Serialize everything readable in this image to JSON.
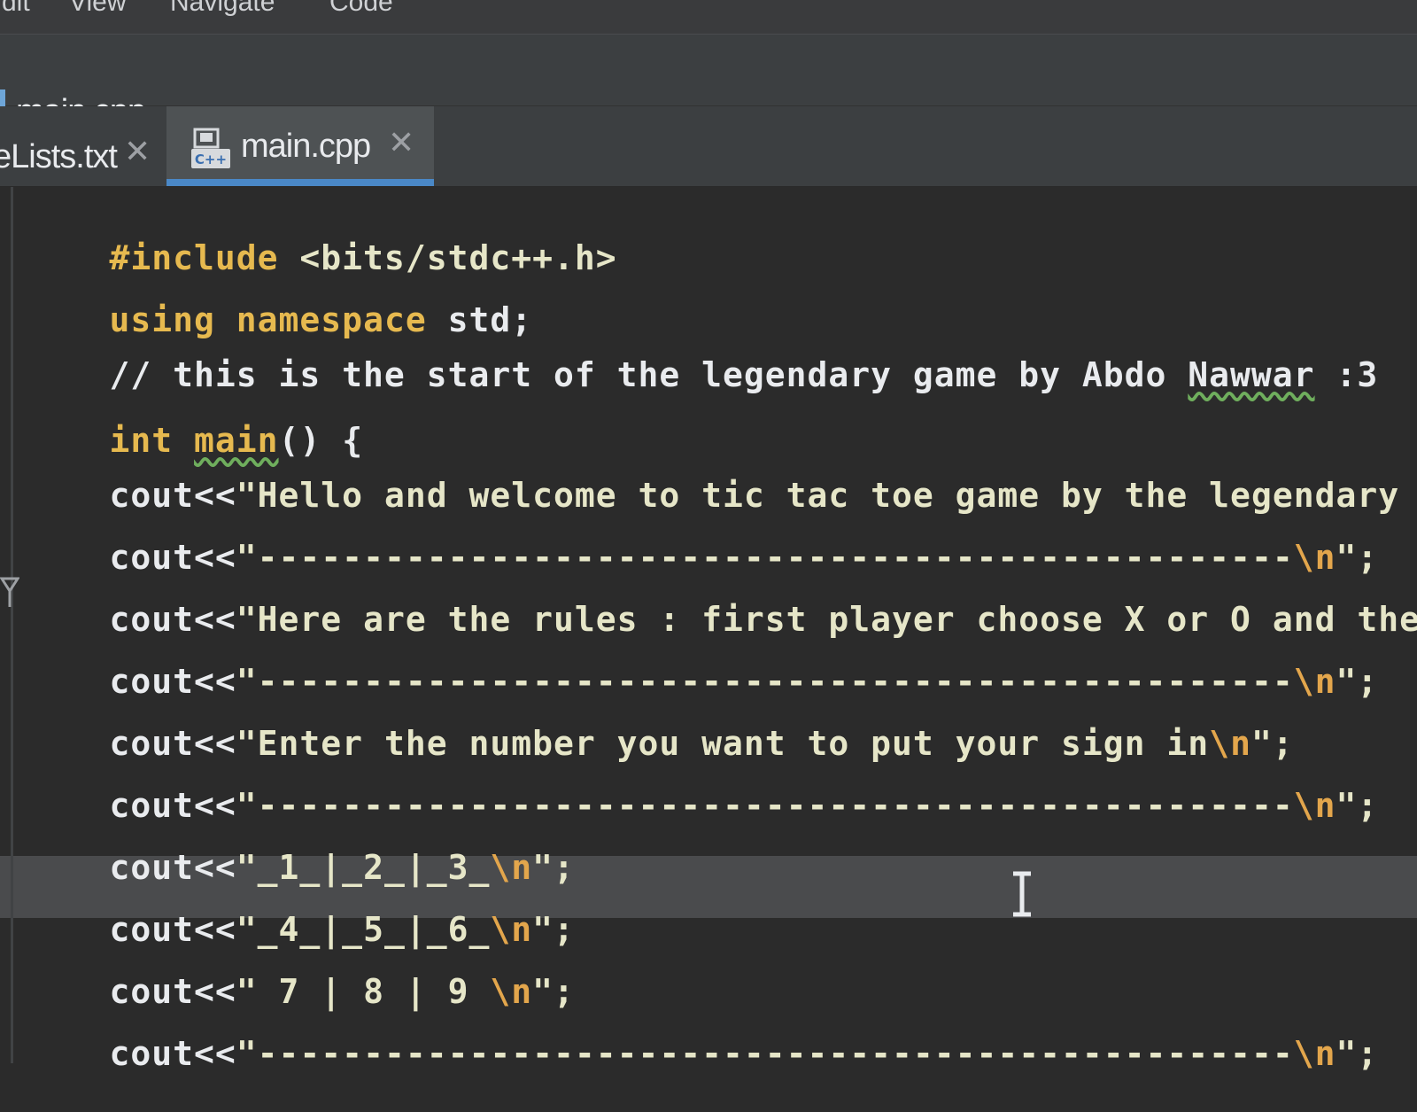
{
  "menubar": {
    "items": [
      "dit",
      "View",
      "Navigate",
      "Code"
    ]
  },
  "breadcrumb": {
    "file": "main.cpp"
  },
  "tabs": [
    {
      "label": "eLists.txt",
      "active": false
    },
    {
      "label": "main.cpp",
      "active": true,
      "icon": "cpp-file-icon"
    }
  ],
  "editor": {
    "lines": {
      "l1": {
        "kw": "#include",
        "text": " <bits/stdc++.h>"
      },
      "l2": {
        "kw1": "using",
        "kw2": "namespace",
        "text": " std;"
      },
      "l3": {
        "text": "// this is the start of the legendary game by Abdo ",
        "word": "Nawwar",
        "tail": " :3"
      },
      "l4": {
        "kw": "int",
        "name": "main",
        "tail": "() {"
      },
      "l5": {
        "prefix": "cout<<",
        "str": "\"Hello and welcome to tic tac toe game by the legendary"
      },
      "l6": {
        "prefix": "cout<<",
        "str": "\"-------------------------------------------------",
        "esc": "\\n",
        "tail": "\";"
      },
      "l7": {
        "prefix": "cout<<",
        "str": "\"Here are the rules : first player choose X or O and the"
      },
      "l8": {
        "prefix": "cout<<",
        "str": "\"-------------------------------------------------",
        "esc": "\\n",
        "tail": "\";"
      },
      "l9": {
        "prefix": "cout<<",
        "str": "\"Enter the number you want to put your sign in",
        "esc": "\\n",
        "tail": "\";"
      },
      "l10": {
        "prefix": "cout<<",
        "str": "\"-------------------------------------------------",
        "esc": "\\n",
        "tail": "\";"
      },
      "l11": {
        "prefix": "cout<<",
        "str": "\"_1_|_2_|_3_",
        "esc": "\\n",
        "tail": "\";"
      },
      "l12": {
        "prefix": "cout<<",
        "str": "\"_4_|_5_|_6_",
        "esc": "\\n",
        "tail": "\";"
      },
      "l13": {
        "prefix": "cout<<",
        "str": "\" 7 | 8 | 9 ",
        "esc": "\\n",
        "tail": "\";"
      },
      "l14": {
        "prefix": "cout<<",
        "str": "\"-------------------------------------------------",
        "esc": "\\n",
        "tail": "\";"
      }
    }
  },
  "colors": {
    "background": "#2b2b2b",
    "keyword": "#e6b94f",
    "escape": "#e3a64c",
    "text": "#e9ebee",
    "tab_underline": "#4a88c7",
    "current_line": "#4a4b4d"
  }
}
